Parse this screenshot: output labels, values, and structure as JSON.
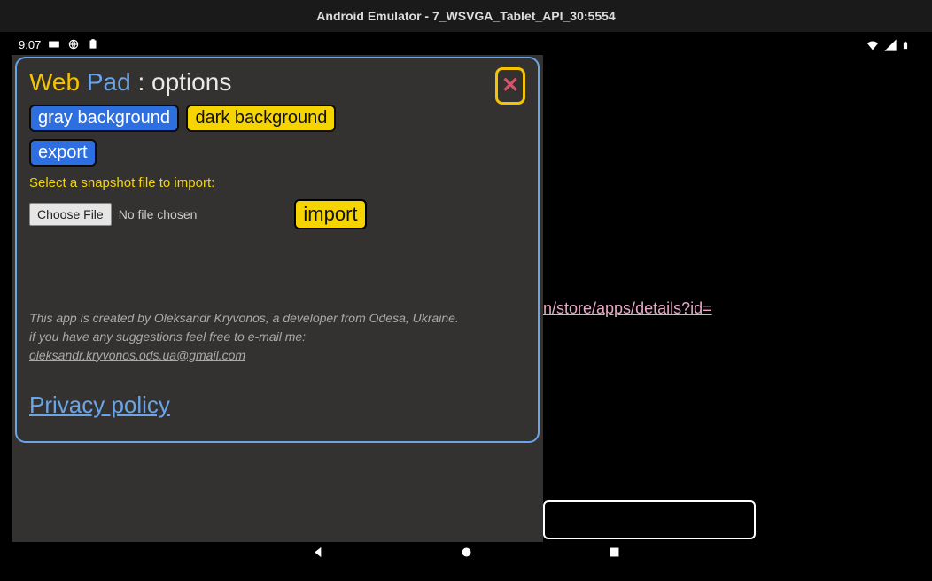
{
  "emulator": {
    "title": "Android Emulator - 7_WSVGA_Tablet_API_30:5554"
  },
  "statusbar": {
    "time": "9:07"
  },
  "background": {
    "link_fragment": "n/store/apps/details?id="
  },
  "dialog": {
    "title_web": "Web",
    "title_pad": "Pad",
    "title_suffix": " : options",
    "gray_bg_btn": "gray background",
    "dark_bg_btn": "dark background",
    "export_btn": "export",
    "import_instruction": "Select a snapshot file to import:",
    "choose_file_btn": "Choose File",
    "file_status": "No file chosen",
    "import_btn": "import",
    "credits_line1": "This app is created by Oleksandr Kryvonos, a developer from Odesa, Ukraine.",
    "credits_line2": "if you have any suggestions feel free to e-mail me:",
    "credits_email": "oleksandr.kryvonos.ods.ua@gmail.com",
    "privacy_link": "Privacy policy"
  }
}
